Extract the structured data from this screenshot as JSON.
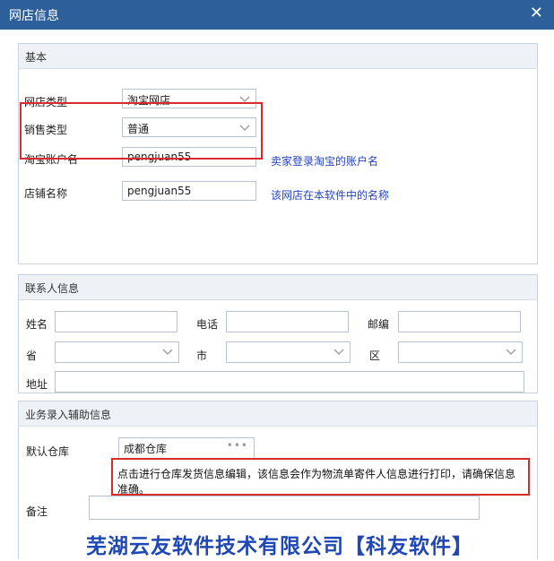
{
  "window": {
    "title": "网店信息",
    "close_symbol": "✕"
  },
  "basic": {
    "section_title": "基本",
    "shop_type": {
      "label": "网店类型",
      "value": "淘宝网店"
    },
    "sales_type": {
      "label": "销售类型",
      "value": "普通"
    },
    "taobao_account": {
      "label": "淘宝账户名",
      "value": "pengjuan55",
      "hint": "卖家登录淘宝的账户名"
    },
    "shop_name": {
      "label": "店铺名称",
      "value": "pengjuan55",
      "hint": "该网店在本软件中的名称"
    }
  },
  "contact": {
    "section_title": "联系人信息",
    "name_label": "姓名",
    "phone_label": "电话",
    "postcode_label": "邮编",
    "province_label": "省",
    "city_label": "市",
    "district_label": "区",
    "address_label": "地址"
  },
  "business": {
    "section_title": "业务录入辅助信息",
    "warehouse_label": "默认仓库",
    "warehouse_value": "成都仓库",
    "warehouse_note": "点击进行仓库发货信息编辑，该信息会作为物流单寄件人信息进行打印，请确保信息准确。",
    "remark_label": "备注"
  },
  "footer": {
    "company": "芜湖云友软件技术有限公司【科友软件】"
  },
  "colors": {
    "titlebar": "#2d5f9a",
    "hint": "#2443c4",
    "highlight": "#d92b2b",
    "footer": "#1f48b6"
  }
}
